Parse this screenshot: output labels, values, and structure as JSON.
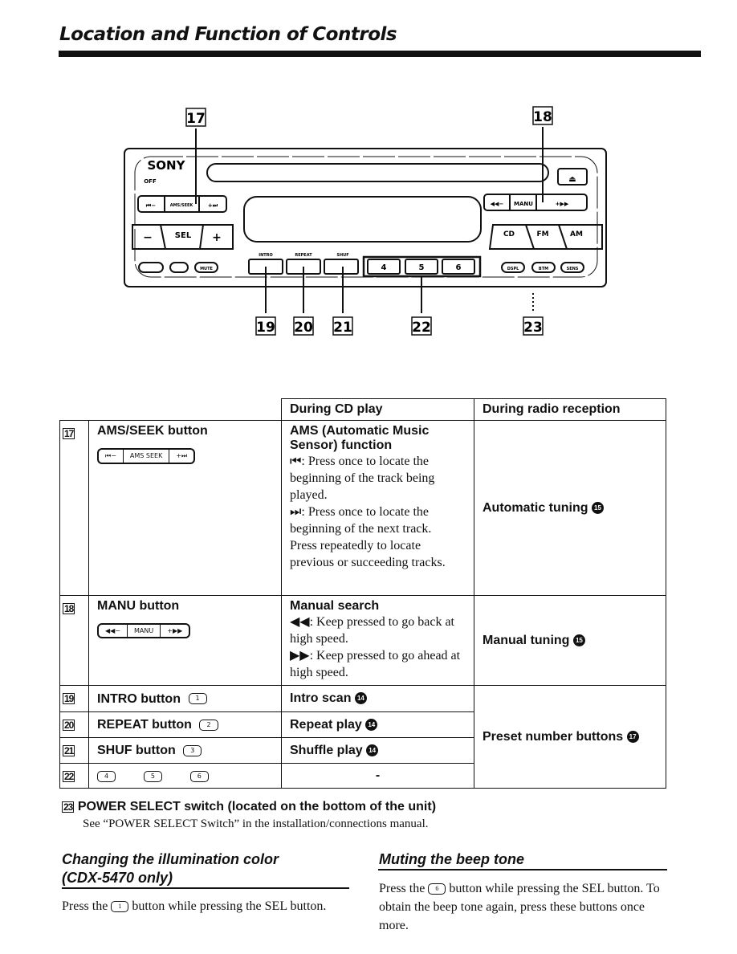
{
  "page": {
    "title": "Location and Function of Controls"
  },
  "figure": {
    "brand": "SONY",
    "callouts": [
      "17",
      "18",
      "19",
      "20",
      "21",
      "22",
      "23"
    ],
    "buttons": {
      "off": "OFF",
      "seek_prev": "⏮−",
      "ams_seek": "AMS/SEEK",
      "seek_next": "+⏭",
      "minus": "−",
      "sel": "SEL",
      "plus": "+",
      "eject": "⏏",
      "manu_prev": "◀◀−",
      "manu": "MANU",
      "manu_next": "+▶▶",
      "cd": "CD",
      "fm": "FM",
      "am": "AM",
      "mute": "MUTE",
      "intro_label": "INTRO",
      "repeat_label": "REPEAT",
      "shuf_label": "SHUF",
      "preset_4": "4",
      "preset_5": "5",
      "preset_6": "6",
      "dsp": "DSPL",
      "btm": "BTM",
      "sens": "SENS"
    }
  },
  "table": {
    "headers": {
      "cd": "During CD play",
      "radio": "During radio reception"
    },
    "rows": [
      {
        "num": "17",
        "name": "AMS/SEEK button",
        "btn": [
          "⏮−",
          "AMS SEEK",
          "+⏭"
        ],
        "cd_title": "AMS (Automatic Music Sensor) function",
        "cd_lines": [
          "⏮: Press once to locate the beginning of the track being played.",
          "⏭: Press once to locate the beginning of the next track.",
          "Press repeatedly to locate previous or succeeding tracks."
        ],
        "radio": "Automatic tuning",
        "radio_ref": "15"
      },
      {
        "num": "18",
        "name": "MANU button",
        "btn": [
          "◀◀−",
          "MANU",
          "+▶▶"
        ],
        "cd_title": "Manual search",
        "cd_lines": [
          "◀◀: Keep pressed to go back at high speed.",
          "▶▶: Keep pressed to go ahead at high speed."
        ],
        "radio": "Manual tuning",
        "radio_ref": "15"
      },
      {
        "num": "19",
        "name": "INTRO button",
        "btn_label": "INTRO",
        "btn_num": "1",
        "cd": "Intro scan",
        "cd_ref": "14"
      },
      {
        "num": "20",
        "name": "REPEAT button",
        "btn_label": "REPEAT",
        "btn_num": "2",
        "cd": "Repeat play",
        "cd_ref": "14"
      },
      {
        "num": "21",
        "name": "SHUF button",
        "btn_label": "SHUF",
        "btn_num": "3",
        "cd": "Shuffle play",
        "cd_ref": "14"
      },
      {
        "num": "22",
        "btns": [
          "4",
          "5",
          "6"
        ],
        "cd": "-"
      }
    ],
    "preset_radio": "Preset number buttons",
    "preset_ref": "17"
  },
  "note23": {
    "num": "23",
    "title": "POWER SELECT switch (located on the bottom of the unit)",
    "text": "See “POWER SELECT Switch” in the installation/connections manual."
  },
  "illumination": {
    "heading1": "Changing the illumination color",
    "heading2": "(CDX-5470 only)",
    "pre": "Press the",
    "btn_label": "INTRO",
    "btn_num": "1",
    "post": "button while pressing the SEL button."
  },
  "muting": {
    "heading": "Muting the beep tone",
    "pre": "Press the",
    "btn_num": "6",
    "post": "button while pressing the SEL button. To obtain the beep tone again, press these buttons once more."
  }
}
